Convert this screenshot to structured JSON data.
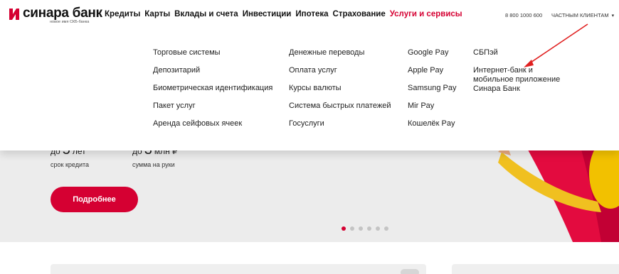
{
  "brand": {
    "name": "синара банк",
    "tagline": "новое имя СКБ-банка",
    "color": "#d50032"
  },
  "nav": {
    "items": [
      {
        "label": "Кредиты"
      },
      {
        "label": "Карты"
      },
      {
        "label": "Вклады и счета"
      },
      {
        "label": "Инвестиции"
      },
      {
        "label": "Ипотека"
      },
      {
        "label": "Страхование"
      },
      {
        "label": "Услуги и сервисы",
        "active": true
      }
    ],
    "phone": "8 800 1000 600",
    "segment": "ЧАСТНЫМ КЛИЕНТАМ",
    "segment_icon": "chevron-down-icon"
  },
  "dropdown": {
    "col1": [
      "Торговые системы",
      "Депозитарий",
      "Биометрическая идентификация",
      "Пакет услуг",
      "Аренда сейфовых ячеек"
    ],
    "col2": [
      "Денежные переводы",
      "Оплата услуг",
      "Курсы валюты",
      "Система быстрых платежей",
      "Госуслуги"
    ],
    "col3": [
      "Google Pay",
      "Apple Pay",
      "Samsung Pay",
      "Mir Pay",
      "Кошелёк Pay"
    ],
    "col4": [
      "СБПэй",
      "Интернет-банк и мобильное приложение Синара Банк"
    ]
  },
  "hero": {
    "stat1": {
      "prefix": "до",
      "value": "5",
      "unit": "лет",
      "label": "срок кредита"
    },
    "stat2": {
      "prefix": "до",
      "value": "3",
      "unit": "млн ₽",
      "label": "сумма на руки"
    },
    "cta_label": "Подробнее",
    "slides": 6,
    "active_slide": 1
  }
}
